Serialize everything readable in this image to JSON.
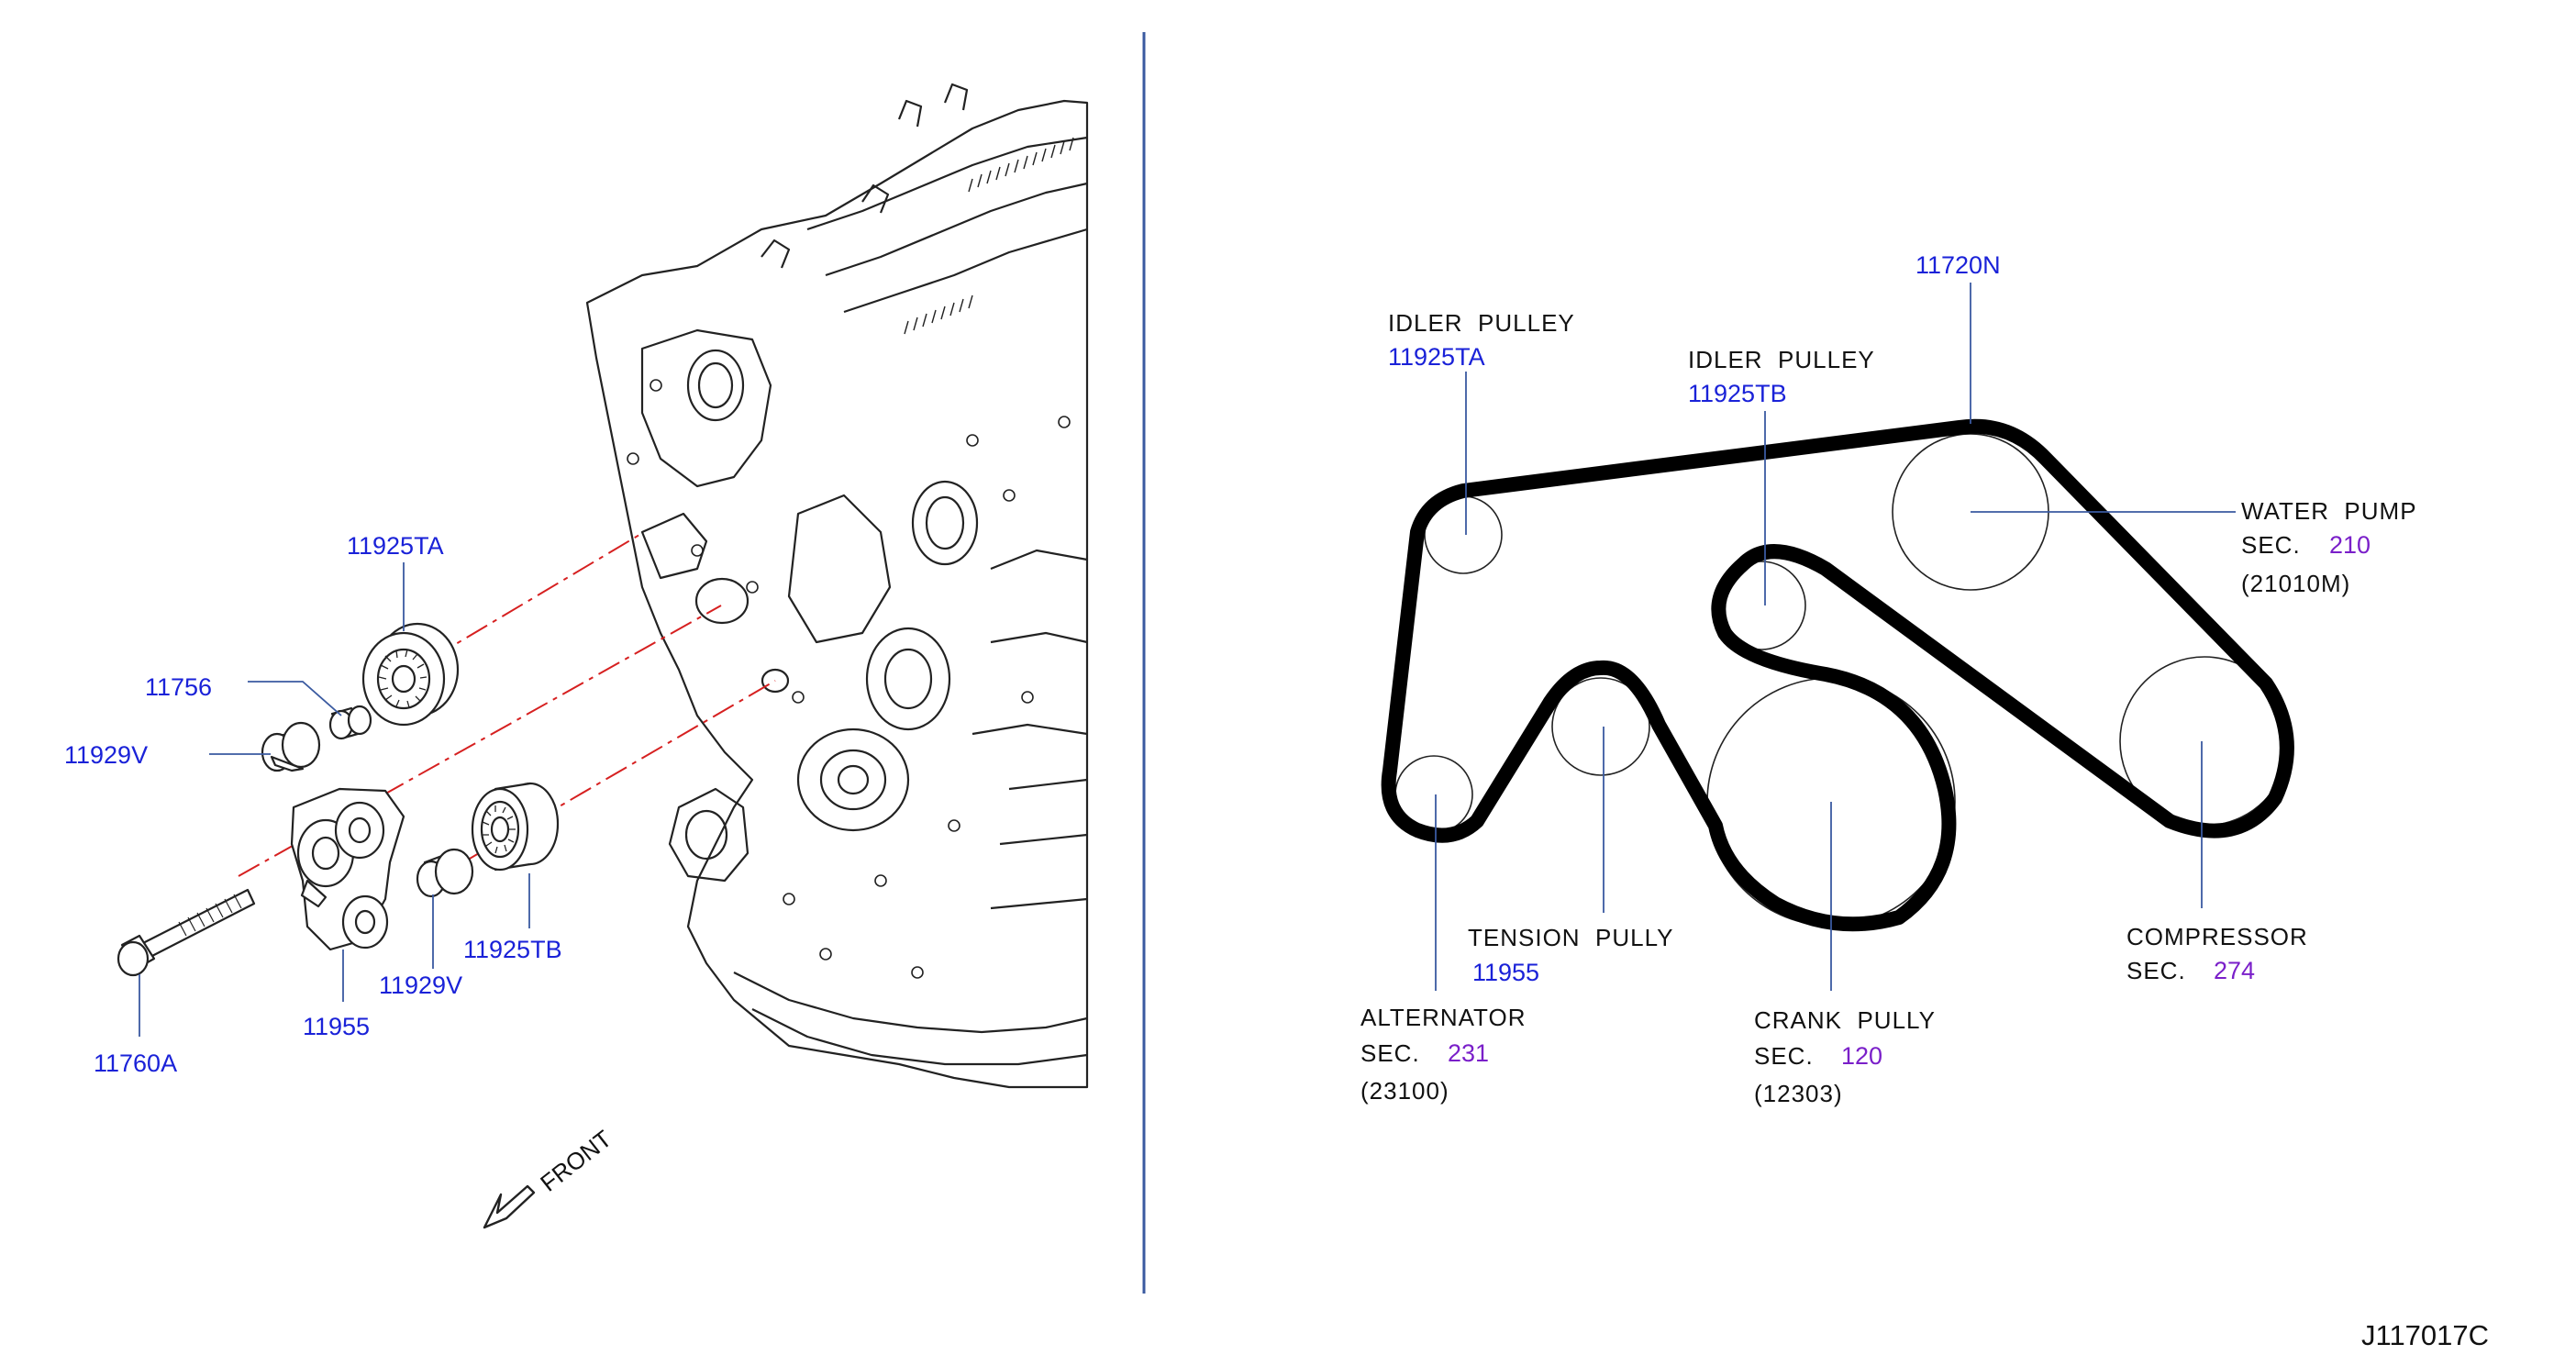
{
  "colors": {
    "part_number": "#1a22d8",
    "section_ref": "#7a1fc9",
    "text": "#111111",
    "divider": "#3a5aa0",
    "leader": "#3a5aa0",
    "centerline": "#d62020",
    "belt": "#000000"
  },
  "left_panel": {
    "parts": {
      "p11925TA": "11925TA",
      "p11756": "11756",
      "p11929V_a": "11929V",
      "p11929V_b": "11929V",
      "p11925TB": "11925TB",
      "p11955": "11955",
      "p11760A": "11760A"
    },
    "front_label": "FRONT"
  },
  "belt_diagram": {
    "belt_part": "11720N",
    "idler_a": {
      "name": "IDLER  PULLEY",
      "part": "11925TA"
    },
    "idler_b": {
      "name": "IDLER  PULLEY",
      "part": "11925TB"
    },
    "water_pump": {
      "name": "WATER  PUMP",
      "sec_label": "SEC.",
      "sec": "210",
      "code": "(21010M)"
    },
    "tension": {
      "name": "TENSION  PULLY",
      "part": "11955"
    },
    "alternator": {
      "name": "ALTERNATOR",
      "sec_label": "SEC.",
      "sec": "231",
      "code": "(23100)"
    },
    "crank": {
      "name": "CRANK  PULLY",
      "sec_label": "SEC.",
      "sec": "120",
      "code": "(12303)"
    },
    "compressor": {
      "name": "COMPRESSOR",
      "sec_label": "SEC.",
      "sec": "274"
    }
  },
  "diagram_id": "J117017C"
}
